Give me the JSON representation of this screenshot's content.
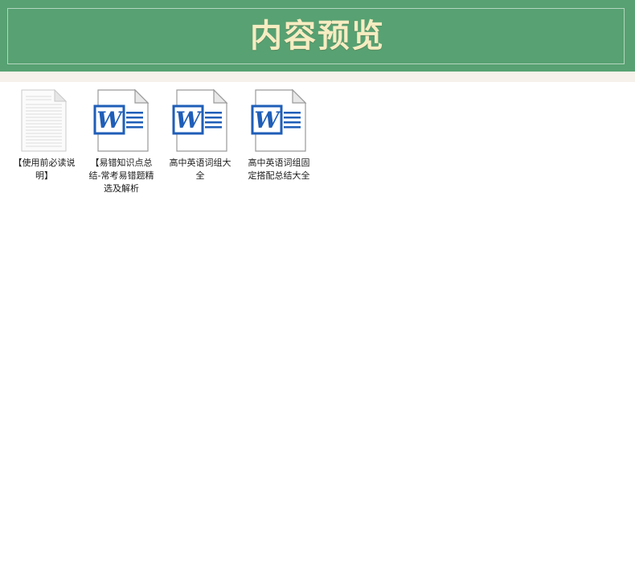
{
  "banner": {
    "title": "内容预览",
    "bg_color": "#57a172",
    "title_color": "#f6ecc2"
  },
  "files": [
    {
      "name": "【使用前必读说明】",
      "icon": "text-document-icon"
    },
    {
      "name": "【易错知识点总结-常考易错题精选及解析",
      "icon": "word-document-icon"
    },
    {
      "name": "高中英语词组大全",
      "icon": "word-document-icon"
    },
    {
      "name": "高中英语词组固定搭配总结大全",
      "icon": "word-document-icon"
    }
  ],
  "colors": {
    "word_blue": "#1f5eb8",
    "page_strip": "#f6f1ea"
  }
}
